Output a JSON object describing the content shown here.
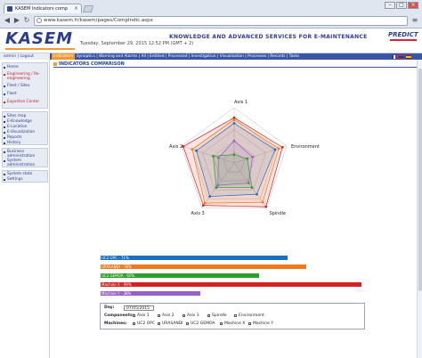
{
  "browser": {
    "tab_title": "KASEM Indicators comp",
    "tab_close": "×",
    "url": "www.kasem.fr/kasem/pages/CompIndic.aspx",
    "url_prefix": "",
    "min": "–",
    "max": "□",
    "close": "×",
    "back": "◀",
    "forward": "▶",
    "reload": "↻",
    "menu": "≡"
  },
  "header": {
    "logo": "KASEM",
    "date": "Tuesday, September 29, 2015 12:52 PM (GMT + 2)",
    "slogan": "KNOWLEDGE AND ADVANCED SERVICES FOR E-MAINTENANCE",
    "brand": "PREDICT"
  },
  "userbar": {
    "text": "admin | Logout"
  },
  "menu": {
    "active": "indicators",
    "items": "Synoptics | Warning and Alarms | All | Entitled | Processed | Investigation | Visualization | Processes | Records | Tasks"
  },
  "sidebar": {
    "group1": [
      "Home",
      "Engineering / Re-engineering",
      "Fleet / Sites",
      "Fleet",
      "Expertise Center"
    ],
    "group2": [
      "Sites map",
      "E-Knowledge",
      "E-Location",
      "E-Visualization",
      "Reports",
      "History"
    ],
    "group3": [
      "Business administration",
      "System administration"
    ],
    "group4": [
      "System state",
      "Settings"
    ]
  },
  "content": {
    "title": "INDICATORS COMPARISON"
  },
  "radar": {
    "axes": [
      "Axis 1",
      "Environment",
      "Spindle",
      "Axis 3",
      "Axis 2"
    ]
  },
  "bars": [
    {
      "label": "UC2 OPC - 71%",
      "value": 71,
      "color": "#1a6fc0"
    },
    {
      "label": "URASANDI - 78%",
      "value": 78,
      "color": "#f07a1a"
    },
    {
      "label": "UC2 GEMOA - 60%",
      "value": 60,
      "color": "#2aa02a"
    },
    {
      "label": "Machine X - 99%",
      "value": 99,
      "color": "#d62020"
    },
    {
      "label": "Machine Y - 38%",
      "value": 38,
      "color": "#9a5fc8"
    }
  ],
  "filter": {
    "day_label": "Day:",
    "day_value": "07/05/2015",
    "components_label": "Components:",
    "components": [
      "Axis 1",
      "Axis 2",
      "Axis 3",
      "Spindle",
      "Environment"
    ],
    "machines_label": "Machines:",
    "machines": [
      "UC2 OPC",
      "URASANDI",
      "UC2 GEMOA",
      "Machine X",
      "Machine Y"
    ]
  }
}
